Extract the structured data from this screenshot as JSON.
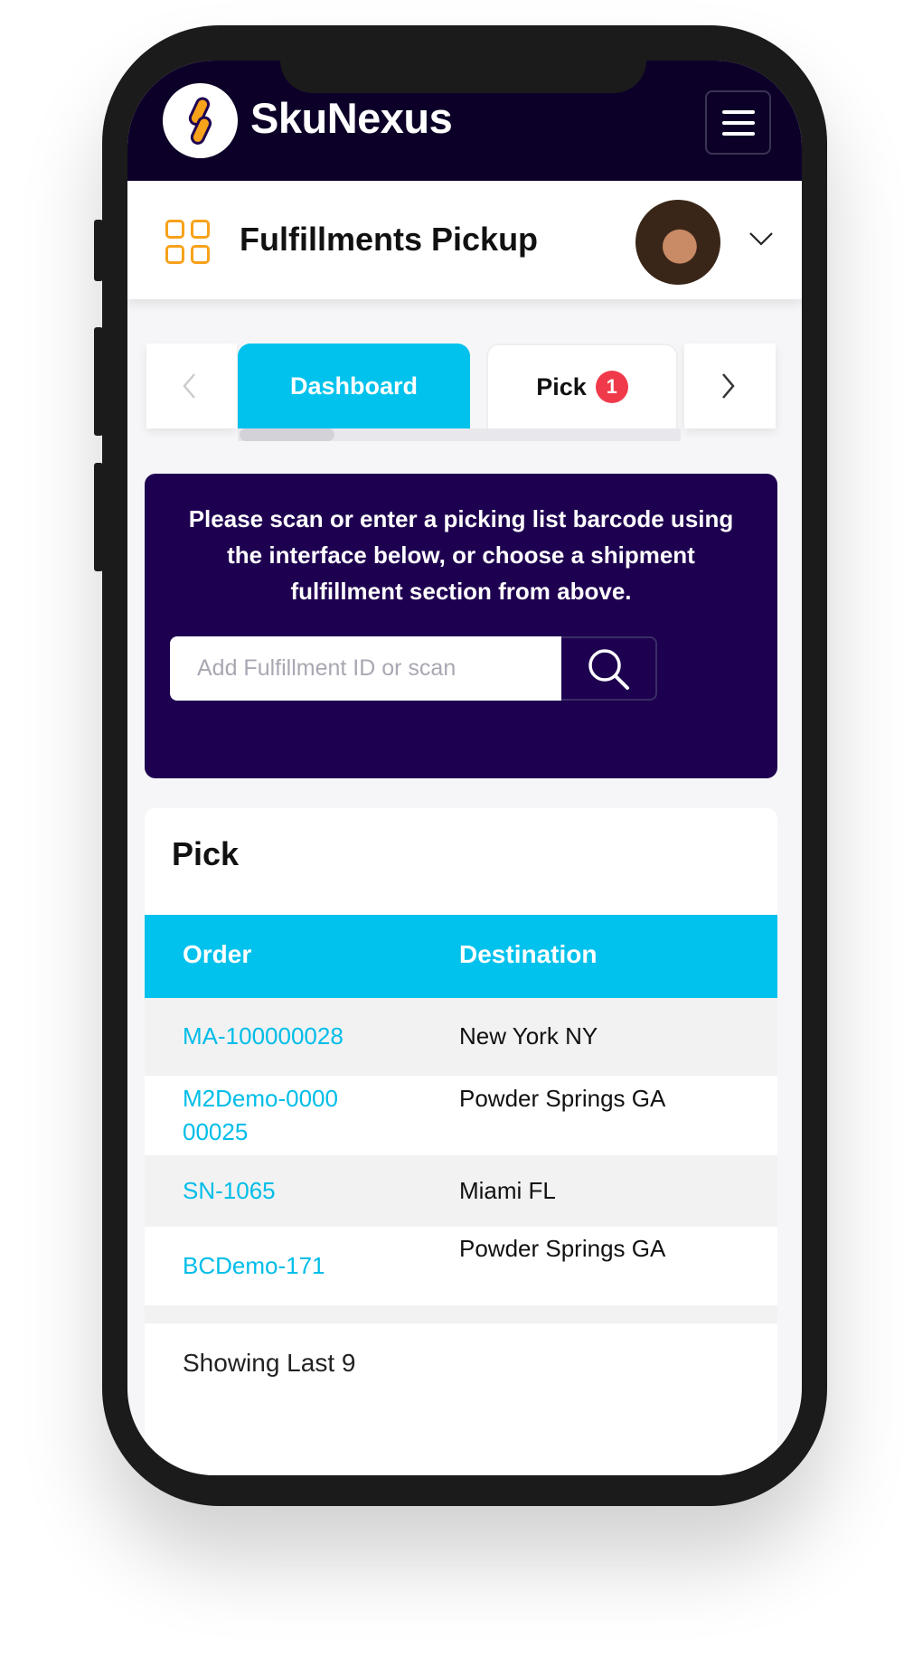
{
  "app": {
    "brand": "SkuNexus",
    "logo_icon": "skunexus-logo-icon",
    "menu_icon": "hamburger-icon"
  },
  "header": {
    "title": "Fulfillments Pickup",
    "grid_icon": "grid-icon",
    "avatar": "user-avatar",
    "dropdown_icon": "chevron-down-icon"
  },
  "tabs": [
    {
      "label": "Dashboard",
      "active": true
    },
    {
      "label": "Pick",
      "badge": "1"
    }
  ],
  "scan": {
    "instructions": "Please scan or enter a picking list barcode using the interface below, or choose a shipment fulfillment section from above.",
    "placeholder": "Add Fulfillment ID or scan",
    "search_icon": "search-icon"
  },
  "pick": {
    "title": "Pick",
    "columns": [
      "Order",
      "Destination"
    ],
    "rows": [
      {
        "order": "MA-100000028",
        "destination": "New York NY"
      },
      {
        "order": "M2Demo-000000025",
        "destination": "Powder Springs GA"
      },
      {
        "order": "SN-1065",
        "destination": "Miami FL"
      },
      {
        "order": "BCDemo-171",
        "destination": "Powder Springs GA"
      }
    ],
    "footer": "Showing Last 9"
  },
  "colors": {
    "topbar": "#0d0028",
    "accent": "#00c2ec",
    "scan_card": "#1e0050",
    "badge": "#f03a4a",
    "grid_icon": "#f7a21b"
  }
}
